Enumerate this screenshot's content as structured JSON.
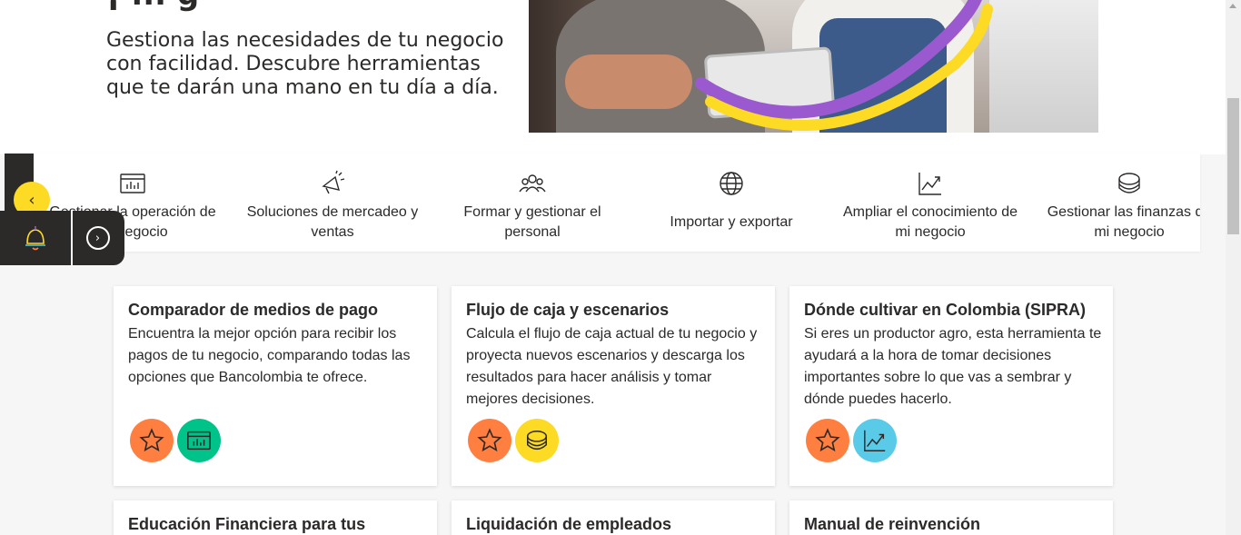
{
  "hero": {
    "title_fragment": "¡ ... g",
    "description": "Gestiona las necesidades de tu negocio con facilidad. Descubre herramientas que te darán una mano en tu día a día."
  },
  "colors": {
    "yellow": "#fdda24",
    "dark": "#2c2a29",
    "orange": "#ff7f41",
    "green": "#00c389",
    "sky": "#59cbe8",
    "purple": "#9b59d0"
  },
  "categories": [
    {
      "label_line1": "Gestionar la operación de",
      "label_line2": "mi negocio",
      "icon": "dashboard-icon"
    },
    {
      "label_line1": "Soluciones de mercadeo y",
      "label_line2": "ventas",
      "icon": "megaphone-icon"
    },
    {
      "label_line1": "Formar y gestionar el",
      "label_line2": "personal",
      "icon": "people-icon"
    },
    {
      "label_line1": "Importar y exportar",
      "label_line2": "",
      "icon": "globe-icon"
    },
    {
      "label_line1": "Ampliar el conocimiento de",
      "label_line2": "mi negocio",
      "icon": "growth-chart-icon"
    },
    {
      "label_line1": "Gestionar las finanzas de",
      "label_line2": "mi negocio",
      "icon": "coins-icon"
    }
  ],
  "cards": [
    {
      "title": "Comparador de medios de pago",
      "description": "Encuentra la mejor opción para recibir los pagos de tu negocio, comparando todas las opciones que Bancolombia te ofrece.",
      "tags": [
        "star-icon",
        "dashboard-icon"
      ]
    },
    {
      "title": "Flujo de caja y escenarios",
      "description": "Calcula el flujo de caja actual de tu negocio y proyecta nuevos escenarios y descarga los resultados para hacer análisis y tomar mejores decisiones.",
      "tags": [
        "star-icon",
        "coins-icon"
      ]
    },
    {
      "title": "Dónde cultivar en Colombia (SIPRA)",
      "description": "Si eres un productor agro, esta herramienta te ayudará a la hora de tomar decisiones importantes sobre lo que vas a sembrar y dónde puedes hacerlo.",
      "tags": [
        "star-icon",
        "growth-chart-icon"
      ]
    }
  ],
  "cards_row2": [
    {
      "title": "Educación Financiera para tus"
    },
    {
      "title": "Liquidación de empleados"
    },
    {
      "title": "Manual de reinvención"
    }
  ],
  "widget": {
    "prev_glyph": "‹",
    "next_glyph": "›"
  }
}
